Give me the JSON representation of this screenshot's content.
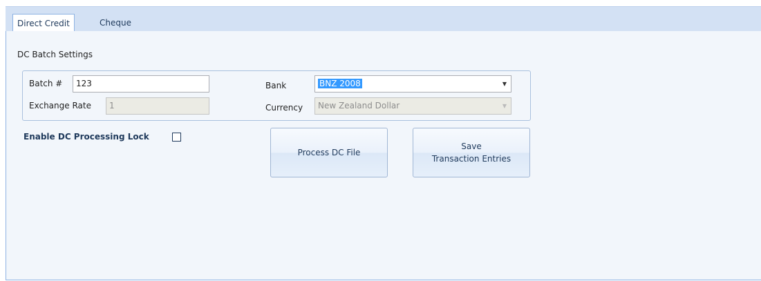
{
  "tabs": [
    {
      "label": "Direct Credit",
      "active": true
    },
    {
      "label": "Cheque",
      "active": false
    }
  ],
  "section": {
    "title": "DC Batch Settings"
  },
  "batch": {
    "label": "Batch #",
    "value": "123"
  },
  "exchange_rate": {
    "label": "Exchange Rate",
    "value": "1"
  },
  "bank": {
    "label": "Bank",
    "value": "BNZ 2008"
  },
  "currency": {
    "label": "Currency",
    "value": "New Zealand Dollar"
  },
  "lock": {
    "label": "Enable DC Processing Lock",
    "checked": false
  },
  "buttons": {
    "process": "Process DC File",
    "save_line1": "Save",
    "save_line2": "Transaction Entries"
  },
  "colors": {
    "tab_strip": "#d3e1f4",
    "panel_background": "#f2f6fb",
    "selection": "#3399ff",
    "label_accent": "#1e395b"
  }
}
